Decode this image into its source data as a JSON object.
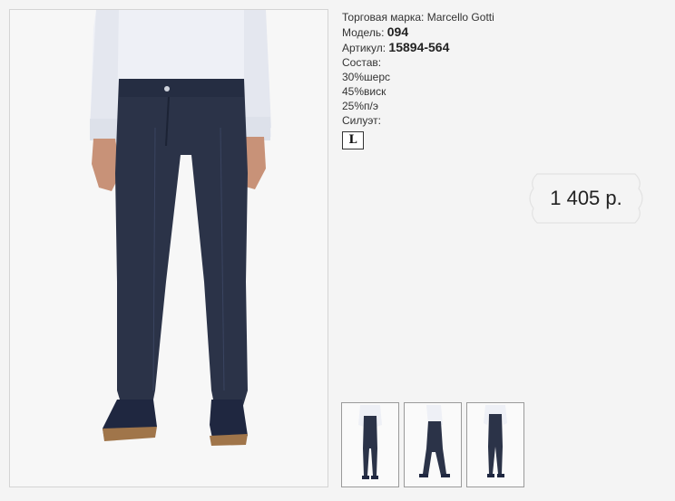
{
  "product": {
    "brand_label": "Торговая марка:",
    "brand_value": "Marcello Gotti",
    "model_label": "Модель:",
    "model_value": "094",
    "article_label": "Артикул:",
    "article_value": "15894-564",
    "composition_label": "Состав:",
    "composition": [
      "30%шерс",
      "45%виск",
      "25%п/э"
    ],
    "silhouette_label": "Силуэт:",
    "silhouette_value": "L",
    "price": "1 405 р."
  },
  "colors": {
    "page_bg": "#f4f4f4",
    "pants": "#2b3348",
    "shirt": "#eef0f6",
    "shoes": "#1f2740",
    "sole": "#a0754a"
  },
  "icons": [
    "price-tag-icon",
    "silhouette-icon"
  ]
}
